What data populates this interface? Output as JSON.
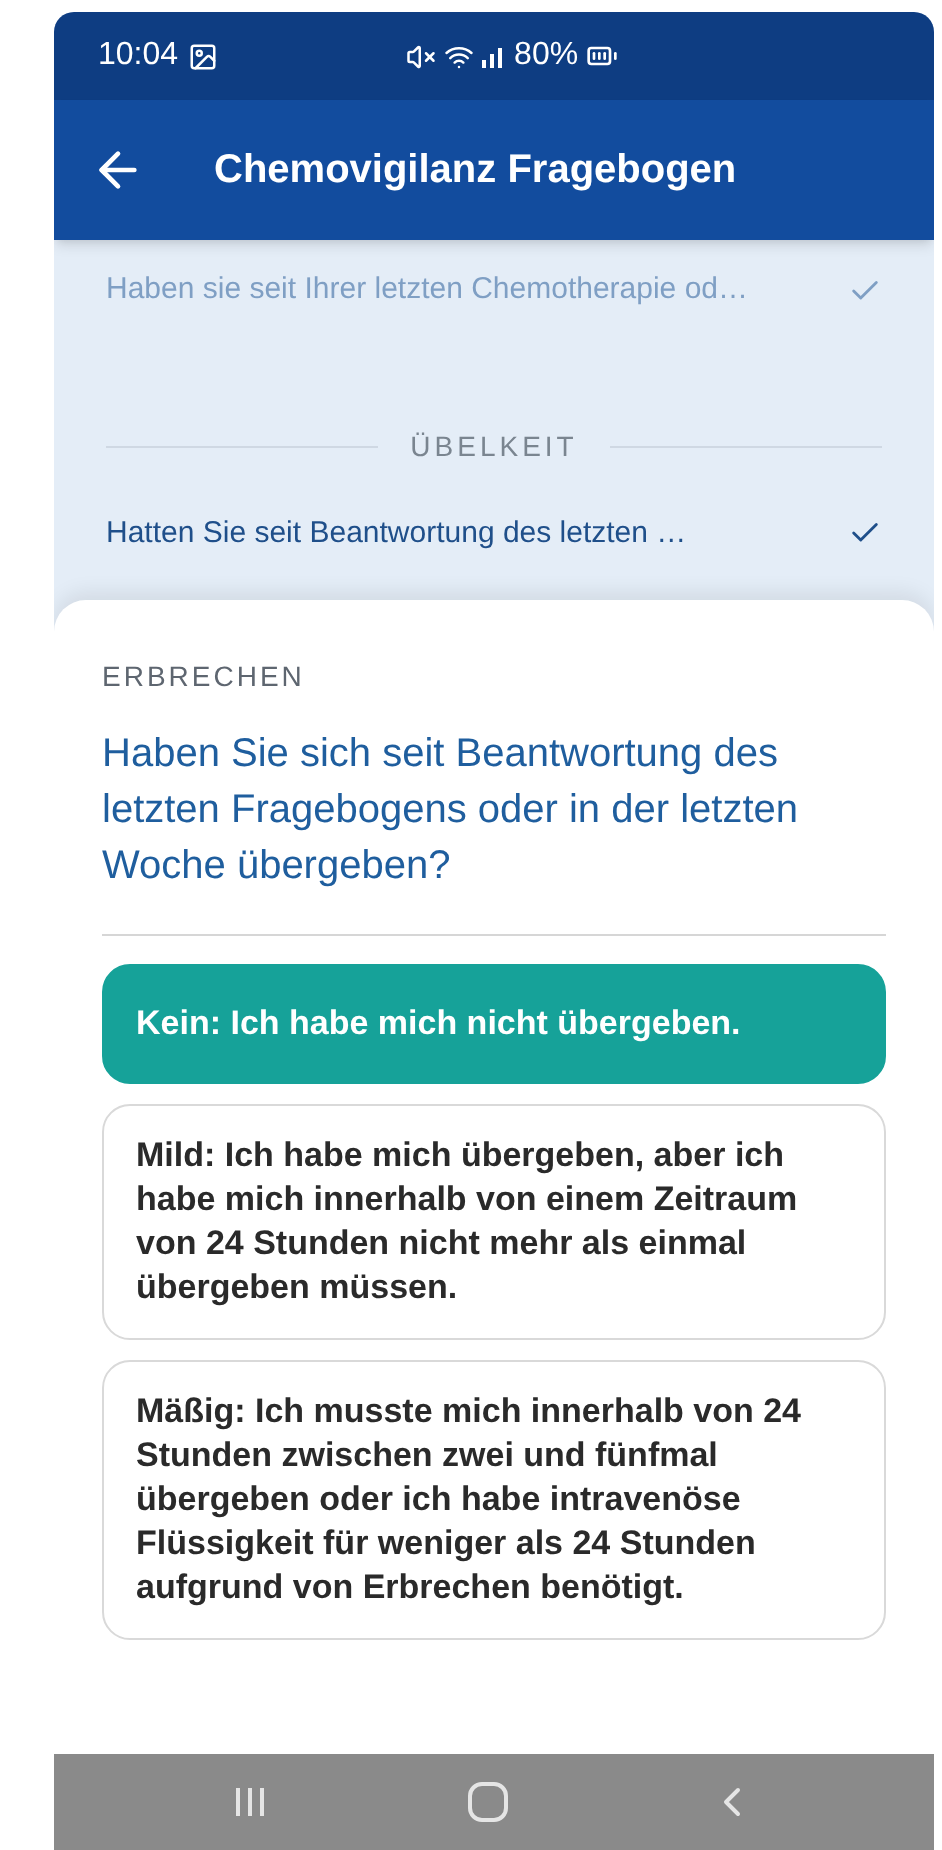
{
  "status_bar": {
    "time": "10:04",
    "battery": "80%"
  },
  "app_bar": {
    "title": "Chemovigilanz Fragebogen"
  },
  "history": [
    {
      "kind": "question",
      "text": "Haben sie seit Ihrer letzten Chemotherapie od…",
      "answered": true,
      "dimmed": true
    },
    {
      "kind": "section",
      "text": "ÜBELKEIT"
    },
    {
      "kind": "question",
      "text": "Hatten Sie seit Beantwortung des letzten …",
      "answered": true,
      "dimmed": false
    }
  ],
  "current": {
    "category": "ERBRECHEN",
    "question": "Haben Sie sich seit Beantwortung des letzten Fragebogens oder in der letzten Woche übergeben?",
    "options": [
      {
        "label": "Kein: Ich habe mich nicht übergeben.",
        "selected": true
      },
      {
        "label": "Mild: Ich habe mich übergeben, aber ich habe mich innerhalb von einem Zeitraum von 24 Stunden nicht mehr als einmal übergeben müssen.",
        "selected": false
      },
      {
        "label": "Mäßig: Ich musste mich innerhalb von 24 Stunden zwischen zwei und fünfmal übergeben oder ich habe intravenöse Flüssigkeit für weniger als 24 Stunden aufgrund von Erbrechen benötigt.",
        "selected": false
      }
    ]
  }
}
